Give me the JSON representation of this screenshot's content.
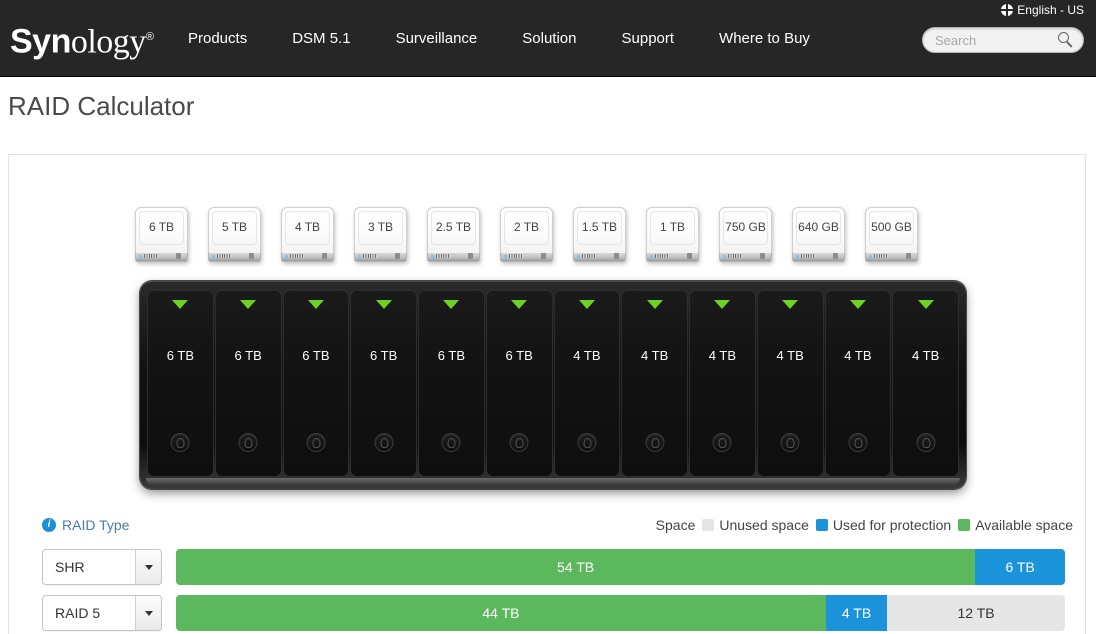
{
  "header": {
    "language": "English - US",
    "globe_icon": "globe-icon",
    "logo_bold": "Syn",
    "logo_thin": "ology",
    "logo_reg": "®",
    "nav": [
      {
        "label": "Products"
      },
      {
        "label": "DSM 5.1"
      },
      {
        "label": "Surveillance"
      },
      {
        "label": "Solution"
      },
      {
        "label": "Support"
      },
      {
        "label": "Where to Buy"
      }
    ],
    "search": {
      "value": "",
      "placeholder": "Search",
      "icon": "search-icon"
    }
  },
  "page": {
    "title": "RAID Calculator"
  },
  "drive_options": [
    {
      "label": "6 TB"
    },
    {
      "label": "5 TB"
    },
    {
      "label": "4 TB"
    },
    {
      "label": "3 TB"
    },
    {
      "label": "2.5 TB"
    },
    {
      "label": "2 TB"
    },
    {
      "label": "1.5 TB"
    },
    {
      "label": "1 TB"
    },
    {
      "label": "750 GB"
    },
    {
      "label": "640 GB"
    },
    {
      "label": "500 GB"
    }
  ],
  "bays": [
    {
      "label": "6 TB"
    },
    {
      "label": "6 TB"
    },
    {
      "label": "6 TB"
    },
    {
      "label": "6 TB"
    },
    {
      "label": "6 TB"
    },
    {
      "label": "6 TB"
    },
    {
      "label": "4 TB"
    },
    {
      "label": "4 TB"
    },
    {
      "label": "4 TB"
    },
    {
      "label": "4 TB"
    },
    {
      "label": "4 TB"
    },
    {
      "label": "4 TB"
    }
  ],
  "controls": {
    "raid_type_label": "RAID Type",
    "info_icon": "info-icon",
    "info_glyph": "i"
  },
  "legend": {
    "title": "Space",
    "items": [
      {
        "label": "Unused space",
        "color": "#e6e6e6"
      },
      {
        "label": "Used for protection",
        "color": "#1a93db"
      },
      {
        "label": "Available space",
        "color": "#5cb85c"
      }
    ]
  },
  "raid_rows": [
    {
      "type": "SHR",
      "segments": [
        {
          "label": "54 TB",
          "kind": "green",
          "pct": 89.9
        },
        {
          "label": "6 TB",
          "kind": "blue",
          "pct": 10.1
        }
      ]
    },
    {
      "type": "RAID 5",
      "segments": [
        {
          "label": "44 TB",
          "kind": "green",
          "pct": 73.1
        },
        {
          "label": "4 TB",
          "kind": "blue",
          "pct": 6.9
        },
        {
          "label": "12 TB",
          "kind": "gray",
          "pct": 20.0
        }
      ]
    }
  ]
}
